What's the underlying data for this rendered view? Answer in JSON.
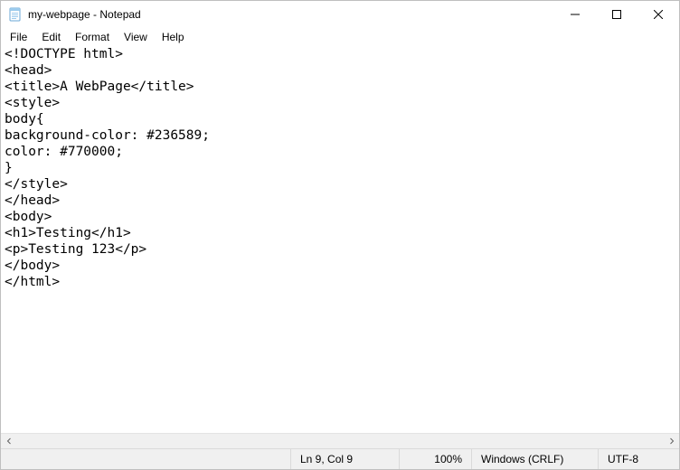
{
  "titlebar": {
    "title": "my-webpage - Notepad"
  },
  "menu": {
    "file": "File",
    "edit": "Edit",
    "format": "Format",
    "view": "View",
    "help": "Help"
  },
  "editor": {
    "content": "<!DOCTYPE html>\n<head>\n<title>A WebPage</title>\n<style>\nbody{\nbackground-color: #236589;\ncolor: #770000;\n}\n</style>\n</head>\n<body>\n<h1>Testing</h1>\n<p>Testing 123</p>\n</body>\n</html>"
  },
  "status": {
    "position": "Ln 9, Col 9",
    "zoom": "100%",
    "line_ending": "Windows (CRLF)",
    "encoding": "UTF-8"
  }
}
